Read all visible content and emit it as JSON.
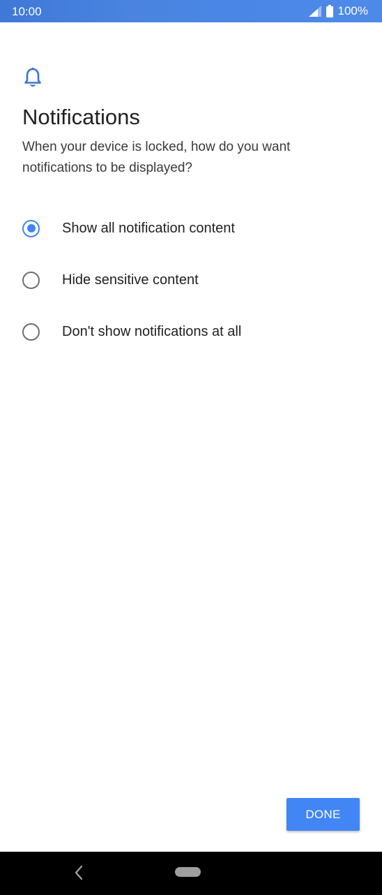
{
  "status_bar": {
    "time": "10:00",
    "battery_text": "100%",
    "signal_icon": "cell-signal-icon",
    "battery_icon": "battery-full-icon"
  },
  "header": {
    "icon": "bell-icon",
    "title": "Notifications",
    "subtitle": "When your device is locked, how do you want notifications to be displayed?"
  },
  "options": [
    {
      "label": "Show all notification content",
      "checked": true
    },
    {
      "label": "Hide sensitive content",
      "checked": false
    },
    {
      "label": "Don't show notifications at all",
      "checked": false
    }
  ],
  "actions": {
    "done_label": "DONE"
  },
  "nav_bar": {
    "back_icon": "back-chevron-icon",
    "home_icon": "home-pill-icon"
  },
  "colors": {
    "accent": "#4285f4",
    "status_bar": "#4a86e6",
    "text_primary": "#212121",
    "nav_bar": "#000000"
  }
}
